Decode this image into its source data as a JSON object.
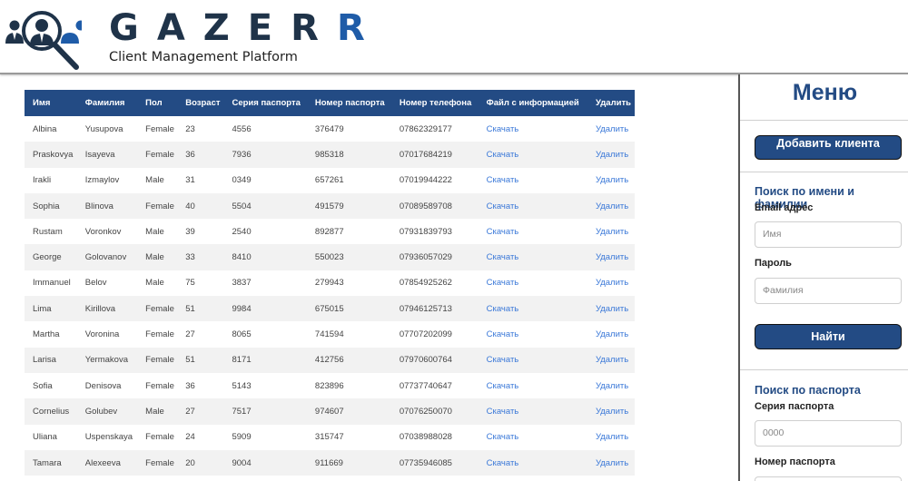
{
  "header": {
    "brand_g": "G",
    "brand_rest": "AZER",
    "brand_accent": "R",
    "subtitle": "Client Management Platform"
  },
  "colors": {
    "primary": "#234b84",
    "link": "#3a78d8",
    "brand_dark": "#1f3349",
    "brand_blue": "#1f5ca8"
  },
  "table": {
    "headers": [
      "Имя",
      "Фамилия",
      "Пол",
      "Возраст",
      "Серия паспорта",
      "Номер паспорта",
      "Номер телефона",
      "Файл с информацией",
      "Удалить"
    ],
    "download_label": "Скачать",
    "delete_label": "Удалить",
    "rows": [
      [
        "Albina",
        "Yusupova",
        "Female",
        "23",
        "4556",
        "376479",
        "07862329177"
      ],
      [
        "Praskovya",
        "Isayeva",
        "Female",
        "36",
        "7936",
        "985318",
        "07017684219"
      ],
      [
        "Irakli",
        "Izmaylov",
        "Male",
        "31",
        "0349",
        "657261",
        "07019944222"
      ],
      [
        "Sophia",
        "Blinova",
        "Female",
        "40",
        "5504",
        "491579",
        "07089589708"
      ],
      [
        "Rustam",
        "Voronkov",
        "Male",
        "39",
        "2540",
        "892877",
        "07931839793"
      ],
      [
        "George",
        "Golovanov",
        "Male",
        "33",
        "8410",
        "550023",
        "07936057029"
      ],
      [
        "Immanuel",
        "Belov",
        "Male",
        "75",
        "3837",
        "279943",
        "07854925262"
      ],
      [
        "Lima",
        "Kirillova",
        "Female",
        "51",
        "9984",
        "675015",
        "07946125713"
      ],
      [
        "Martha",
        "Voronina",
        "Female",
        "27",
        "8065",
        "741594",
        "07707202099"
      ],
      [
        "Larisa",
        "Yermakova",
        "Female",
        "51",
        "8171",
        "412756",
        "07970600764"
      ],
      [
        "Sofia",
        "Denisova",
        "Female",
        "36",
        "5143",
        "823896",
        "07737740647"
      ],
      [
        "Cornelius",
        "Golubev",
        "Male",
        "27",
        "7517",
        "974607",
        "07076250070"
      ],
      [
        "Uliana",
        "Uspenskaya",
        "Female",
        "24",
        "5909",
        "315747",
        "07038988028"
      ],
      [
        "Tamara",
        "Alexeeva",
        "Female",
        "20",
        "9004",
        "911669",
        "07735946085"
      ]
    ]
  },
  "menu": {
    "title": "Меню",
    "add_client": "Добавить клиента",
    "search_name_title": "Поиск по имени и фамилии",
    "email_label": "Email адрес",
    "name_placeholder": "Имя",
    "password_label": "Пароль",
    "surname_placeholder": "Фамилия",
    "find_button": "Найти",
    "search_passport_title": "Поиск по паспорта",
    "passport_series_label": "Серия паспорта",
    "passport_series_placeholder": "0000",
    "passport_number_label": "Номер паспорта"
  }
}
